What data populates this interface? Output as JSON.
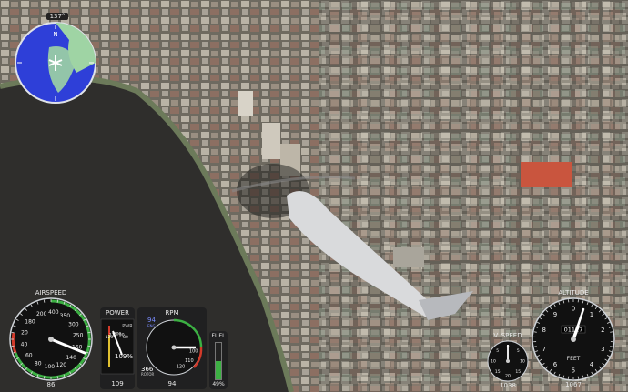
{
  "compass": {
    "heading_label": "137°",
    "north_marker": "N"
  },
  "airspeed": {
    "title": "AIRSPEED",
    "unit_labels": [
      "KTS",
      "KPH"
    ],
    "scale_labels": [
      "200",
      "400",
      "350",
      "300",
      "250",
      "160",
      "140",
      "120",
      "100",
      "80",
      "60",
      "40",
      "20",
      "180"
    ],
    "readout": "86",
    "value": 86
  },
  "power": {
    "title": "POWER",
    "sublabel": "PWR",
    "scale_labels": [
      "120",
      "110",
      "100",
      "90",
      "80"
    ],
    "percent": "109%",
    "readout": "109",
    "value": 109
  },
  "rpm": {
    "title": "RPM",
    "eng_value": "94",
    "eng_label": "ENG",
    "rotor_value": "366",
    "rotor_label": "ROTOR",
    "scale_labels": [
      "100",
      "110",
      "120"
    ],
    "readout": "94",
    "value": 94
  },
  "fuel": {
    "title": "FUEL",
    "readout": "49%",
    "level": 0.49
  },
  "vspeed": {
    "title": "V. SPEED",
    "scale_labels": [
      "0",
      "5",
      "10",
      "15",
      "20",
      "15",
      "10",
      "5"
    ],
    "readout": "1038",
    "value": 1038
  },
  "altitude": {
    "title": "ALTITUDE",
    "counter": "01117",
    "unit": "FEET",
    "scale_labels": [
      "0",
      "1",
      "2",
      "3",
      "4",
      "5",
      "6",
      "7",
      "8",
      "9"
    ],
    "readout": "1067",
    "value": 1067
  },
  "colors": {
    "gauge_ring_green": "#3cb043",
    "gauge_ring_red": "#d23a2a",
    "gauge_ring_yellow": "#e0c030",
    "map_water": "#2e3fd8",
    "map_land": "#9fd4a4",
    "fuel_bar": "#3cb043"
  }
}
